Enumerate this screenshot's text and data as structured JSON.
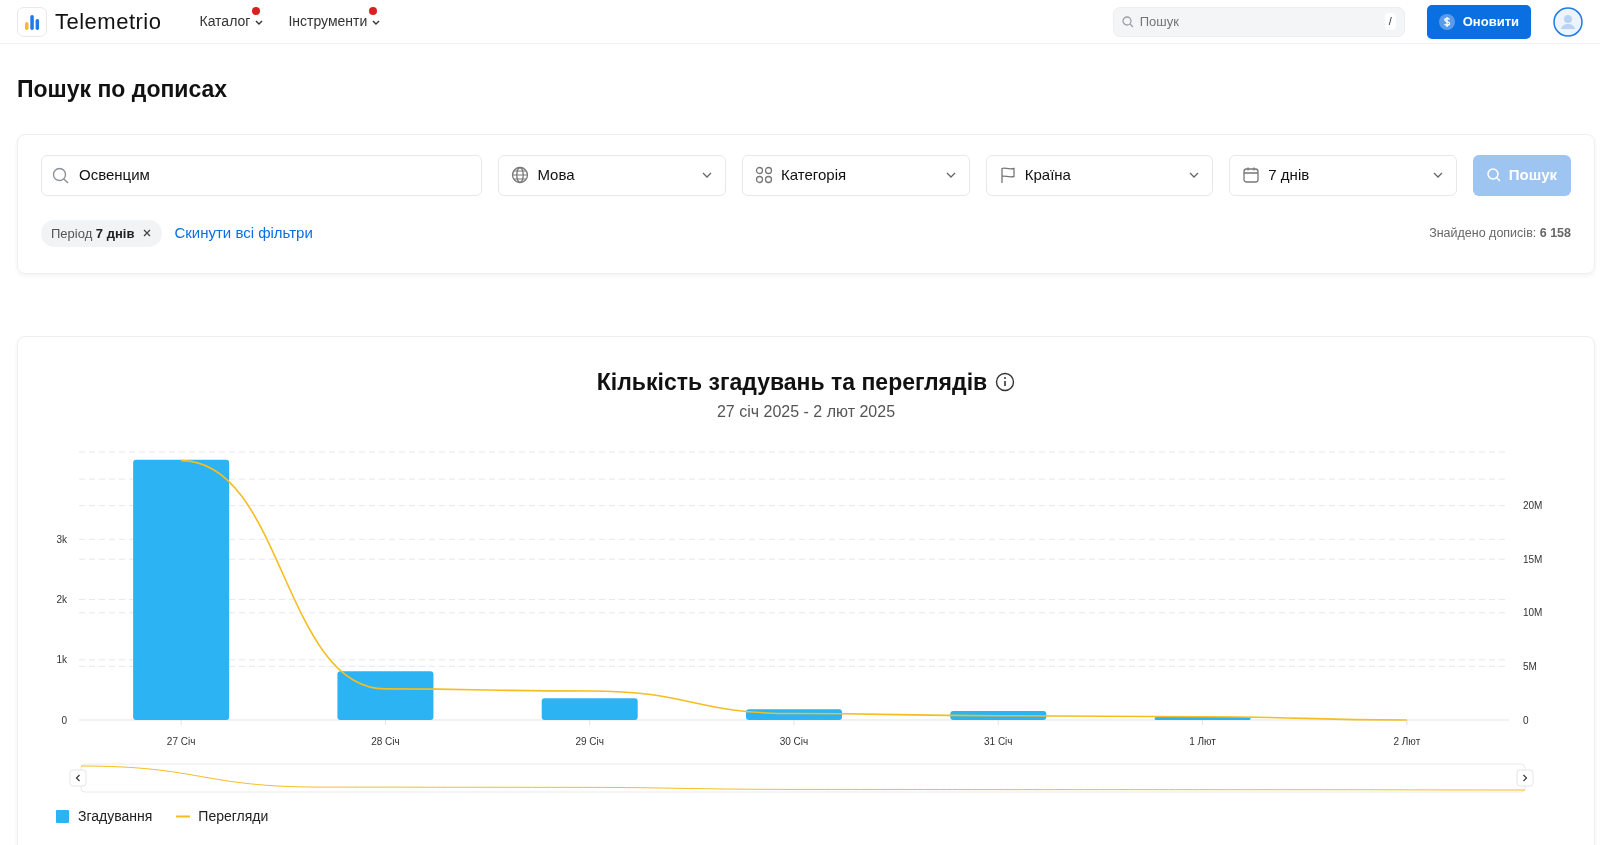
{
  "navbar": {
    "brand": "Telemetrio",
    "menu": [
      {
        "label": "Каталог",
        "badge": true
      },
      {
        "label": "Інструменти",
        "badge": true
      }
    ],
    "search": {
      "placeholder": "Пошук",
      "shortcut": "/"
    },
    "upgrade_button": "Оновити"
  },
  "page_title": "Пошук по дописах",
  "filters": {
    "query": "Освенцим",
    "selects": [
      {
        "kind": "globe",
        "label": "Мова"
      },
      {
        "kind": "grid",
        "label": "Категорія"
      },
      {
        "kind": "flag",
        "label": "Країна"
      },
      {
        "kind": "calendar",
        "label": "7 днів"
      }
    ],
    "search_button": {
      "label": "Пошук",
      "disabled": true
    },
    "chips": [
      {
        "text": "Період **7 днів**"
      }
    ],
    "reset_link": "Скинути всі фільтри",
    "found": "Знайдено дописів: **6 158**"
  },
  "chart": {
    "title": "Кількість згадувань та переглядів",
    "subtitle": "27 січ 2025 - 2 лют 2025",
    "chart_data": {
      "type": "bar",
      "categories": [
        "27 Січ",
        "28 Січ",
        "29 Січ",
        "30 Січ",
        "31 Січ",
        "1 Лют",
        "2 Лют"
      ],
      "grid": true,
      "ylim": [
        0,
        4450
      ],
      "yticks": [
        {
          "value": 0,
          "label": "0"
        },
        {
          "value": 1000,
          "label": "1k"
        },
        {
          "value": 2000,
          "label": "2k"
        },
        {
          "value": 3000,
          "label": "3k"
        }
      ],
      "y2lim": [
        0,
        25000000
      ],
      "y2ticks": [
        {
          "value": 0,
          "label": "0"
        },
        {
          "value": 5000000,
          "label": "5M"
        },
        {
          "value": 10000000,
          "label": "10M"
        },
        {
          "value": 15000000,
          "label": "15M"
        },
        {
          "value": 20000000,
          "label": "20M"
        }
      ],
      "series": [
        {
          "name": "Згадування",
          "type": "bar",
          "color": "#2bb3f3",
          "values": [
            4320,
            810,
            360,
            180,
            150,
            50,
            0
          ]
        },
        {
          "name": "Перегляди",
          "type": "line",
          "axis": "y2",
          "color": "#f5bd1f",
          "values": [
            24200000,
            2900000,
            2700000,
            600000,
            400000,
            300000,
            0
          ]
        }
      ]
    }
  }
}
